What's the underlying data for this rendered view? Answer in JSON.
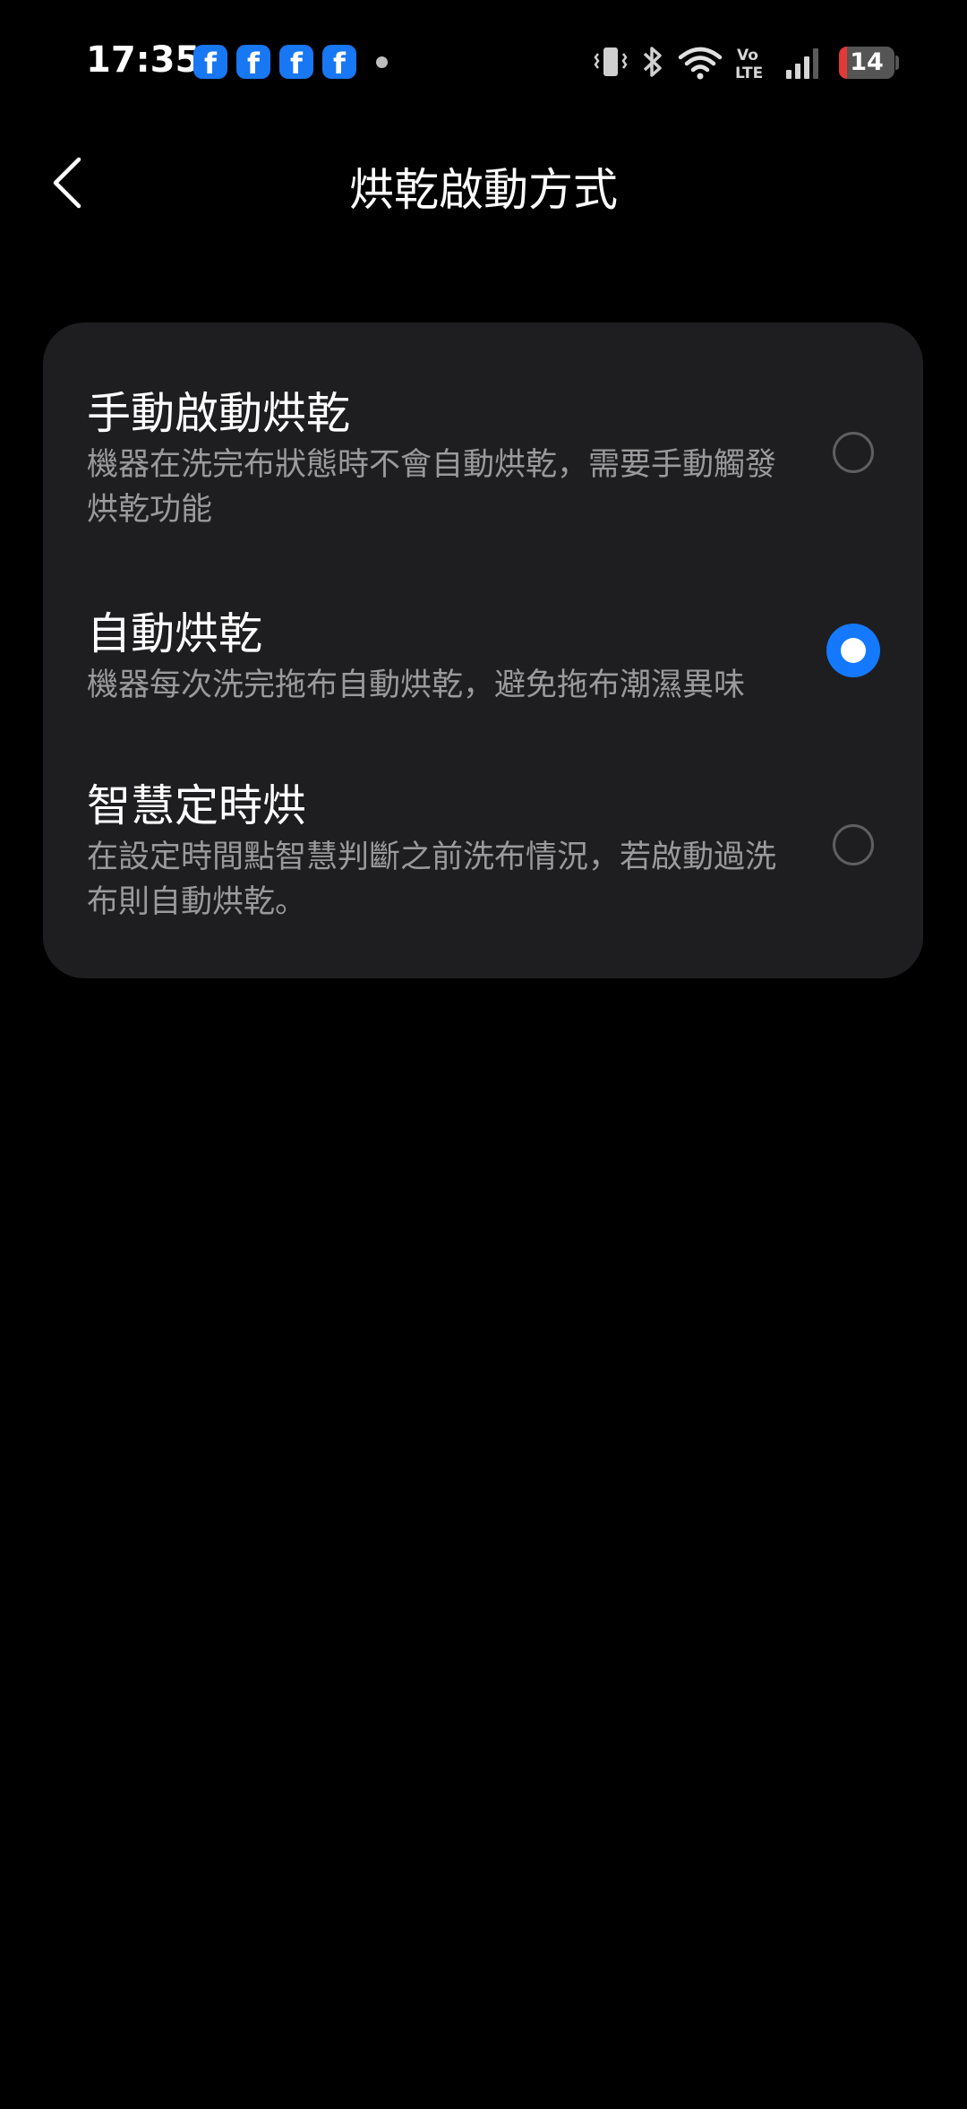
{
  "status_bar": {
    "time": "17:35",
    "notification_icons": [
      "facebook-icon",
      "facebook-icon",
      "facebook-icon",
      "facebook-icon"
    ],
    "facebook_glyph": "f",
    "battery_level": "14",
    "battery_color": "#e53935"
  },
  "header": {
    "title": "烘乾啟動方式"
  },
  "options": [
    {
      "title": "手動啟動烘乾",
      "description": "機器在洗完布狀態時不會自動烘乾，需要手動觸發烘乾功能",
      "selected": false
    },
    {
      "title": "自動烘乾",
      "description": "機器每次洗完拖布自動烘乾，避免拖布潮濕異味",
      "selected": true
    },
    {
      "title": "智慧定時烘",
      "description": "在設定時間點智慧判斷之前洗布情況，若啟動過洗布則自動烘乾。",
      "selected": false
    }
  ],
  "colors": {
    "accent": "#1479ff",
    "card_background": "#1e1e20",
    "page_background": "#000000"
  }
}
